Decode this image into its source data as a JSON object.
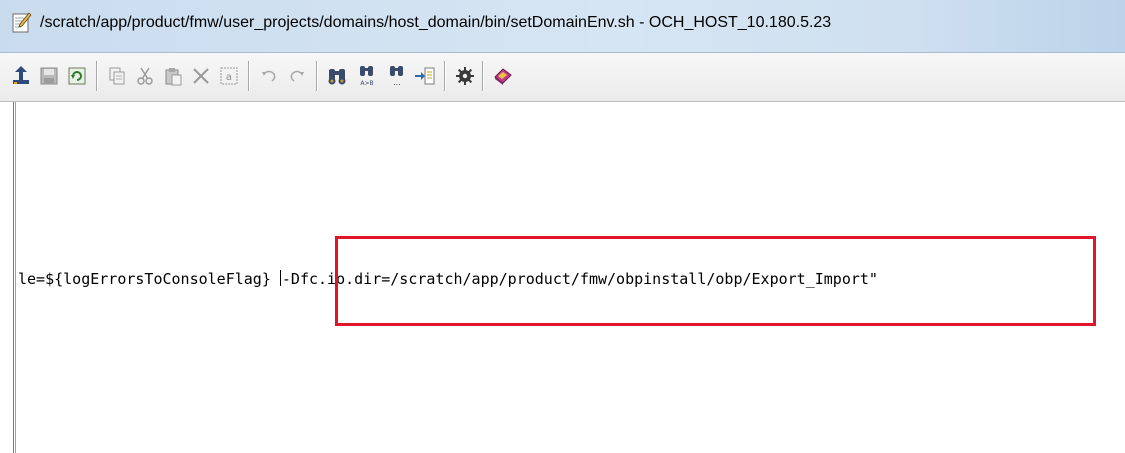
{
  "window": {
    "title": "/scratch/app/product/fmw/user_projects/domains/host_domain/bin/setDomainEnv.sh - OCH_HOST_10.180.5.23",
    "title_icon": "edit-file-icon"
  },
  "toolbar": {
    "buttons": [
      {
        "name": "upload-icon",
        "enabled": true
      },
      {
        "name": "save-icon",
        "enabled": false
      },
      {
        "name": "refresh-icon",
        "enabled": true
      },
      {
        "name": "copy-icon",
        "enabled": false
      },
      {
        "name": "cut-icon",
        "enabled": false
      },
      {
        "name": "paste-icon",
        "enabled": false
      },
      {
        "name": "delete-icon",
        "enabled": false
      },
      {
        "name": "select-all-icon",
        "enabled": false
      },
      {
        "name": "undo-icon",
        "enabled": false
      },
      {
        "name": "redo-icon",
        "enabled": false
      },
      {
        "name": "find-icon",
        "enabled": true
      },
      {
        "name": "replace-icon",
        "enabled": true
      },
      {
        "name": "find-next-icon",
        "enabled": true
      },
      {
        "name": "goto-line-icon",
        "enabled": true
      },
      {
        "name": "settings-icon",
        "enabled": true
      },
      {
        "name": "help-icon",
        "enabled": true
      }
    ],
    "colors": {
      "enabled": "#3a4a6a",
      "disabled": "#9a9a9a",
      "accent": "#c8a020"
    }
  },
  "editor": {
    "line_prefix": "le=${logErrorsToConsoleFlag} ",
    "line_highlighted": "-Dfc.io.dir=/scratch/app/product/fmw/obpinstall/obp/Export_Import\"",
    "highlight_color": "#e0142b"
  }
}
